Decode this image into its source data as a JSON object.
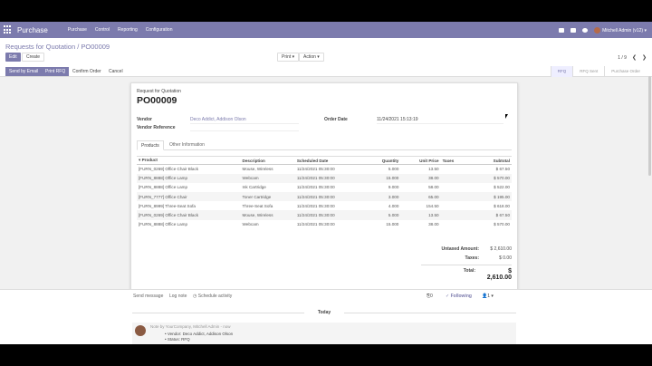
{
  "nav": {
    "brand": "Purchase",
    "menu": [
      "Purchase",
      "Control",
      "Reporting",
      "Configuration"
    ],
    "user": "Mitchell Admin (v12)"
  },
  "breadcrumb": {
    "parent": "Requests for Quotation",
    "sep": " / ",
    "current": "PO00009"
  },
  "buttons": {
    "edit": "Edit",
    "create": "Create",
    "print": "Print",
    "action": "Action"
  },
  "pager": {
    "text": "1 / 9"
  },
  "statusbar": {
    "send_email": "Send by Email",
    "print_rfq": "Print RFQ",
    "confirm": "Confirm Order",
    "cancel": "Cancel",
    "stages": [
      "RFQ",
      "RFQ Sent",
      "Purchase Order"
    ]
  },
  "form": {
    "doc_type": "Request for Quotation",
    "name": "PO00009",
    "vendor_label": "Vendor",
    "vendor_value": "Deco Addict, Addison Olson",
    "vendor_ref_label": "Vendor Reference",
    "order_date_label": "Order Date",
    "order_date_value": "11/24/2021 15:13:19",
    "tabs": [
      "Products",
      "Other Information"
    ]
  },
  "lines": {
    "headers": [
      "Product",
      "Description",
      "Scheduled Date",
      "Quantity",
      "Unit Price",
      "Taxes",
      "Subtotal"
    ],
    "rows": [
      [
        "[FURN_0269] Office Chair Black",
        "Mouse, Wireless",
        "11/24/2021 05:30:00",
        "5.000",
        "13.50",
        "",
        "$ 67.50"
      ],
      [
        "[FURN_8888] Office Lamp",
        "Webcam",
        "11/24/2021 05:30:00",
        "15.000",
        "38.00",
        "",
        "$ 570.00"
      ],
      [
        "[FURN_8888] Office Lamp",
        "Ink Cartridge",
        "11/24/2021 05:30:00",
        "9.000",
        "58.00",
        "",
        "$ 522.00"
      ],
      [
        "[FURN_7777] Office Chair",
        "Toner Cartridge",
        "11/24/2021 05:30:00",
        "3.000",
        "65.00",
        "",
        "$ 195.00"
      ],
      [
        "[FURN_8999] Three-Seat Sofa",
        "Three-Seat Sofa",
        "11/24/2021 05:30:00",
        "4.000",
        "154.50",
        "",
        "$ 618.00"
      ],
      [
        "[FURN_0269] Office Chair Black",
        "Mouse, Wireless",
        "11/24/2021 05:30:00",
        "5.000",
        "13.50",
        "",
        "$ 67.50"
      ],
      [
        "[FURN_8888] Office Lamp",
        "Webcam",
        "11/24/2021 05:30:00",
        "15.000",
        "38.00",
        "",
        "$ 570.00"
      ]
    ]
  },
  "totals": {
    "untaxed_label": "Untaxed Amount:",
    "untaxed": "$ 2,610.00",
    "taxes_label": "Taxes:",
    "taxes": "$ 0.00",
    "total_label": "Total:",
    "total": "$ 2,610.00"
  },
  "chatter": {
    "send_message": "Send message",
    "log_note": "Log note",
    "schedule": "Schedule activity",
    "attachments": "0",
    "following": "Following",
    "followers": "1",
    "today": "Today",
    "msg_head": "Note by YourCompany, Mitchell Admin - now",
    "msg_lines": [
      "Vendor: Deco Addict, Addison Olson",
      "Status: RFQ"
    ]
  },
  "colors": {
    "brand": "#7c7bad"
  }
}
